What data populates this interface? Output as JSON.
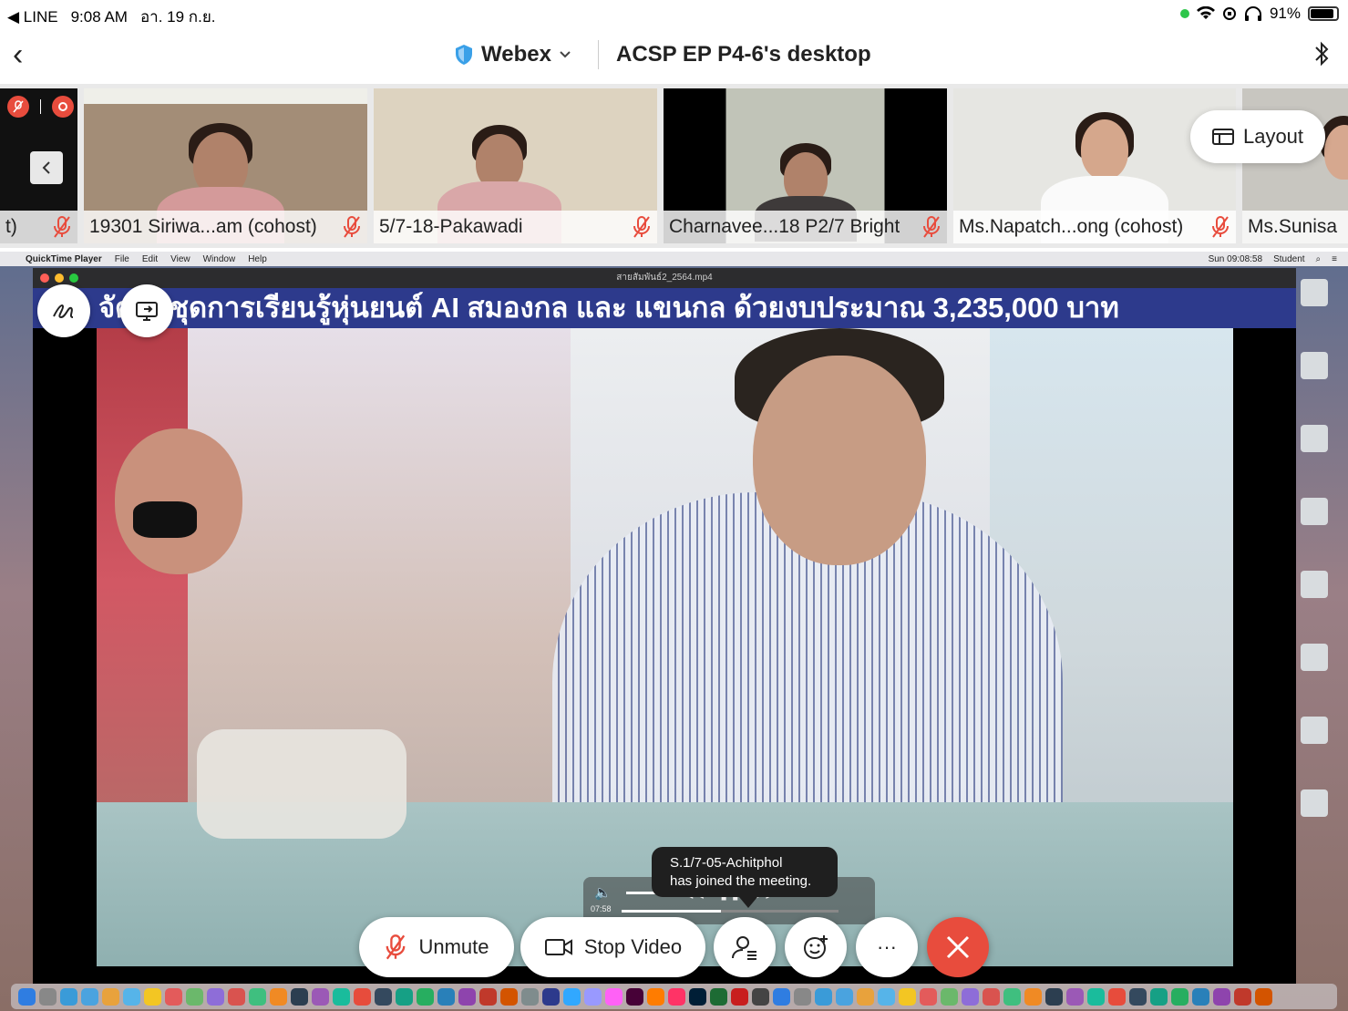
{
  "status_bar": {
    "back_app": "◀ LINE",
    "time": "9:08 AM",
    "date": "อา. 19 ก.ย.",
    "battery": "91%",
    "battery_level": 0.91
  },
  "nav": {
    "app_name": "Webex",
    "title": "ACSP EP P4-6's desktop"
  },
  "participants": [
    {
      "name": "t)"
    },
    {
      "name": "19301 Siriwa...am (cohost)"
    },
    {
      "name": "5/7-18-Pakawadi"
    },
    {
      "name": "Charnavee...18 P2/7 Bright"
    },
    {
      "name": "Ms.Napatch...ong (cohost)"
    },
    {
      "name": "Ms.Sunisa C"
    }
  ],
  "layout_button": "Layout",
  "shared_screen": {
    "menubar": {
      "app": "QuickTime Player",
      "items": [
        "File",
        "Edit",
        "View",
        "Window",
        "Help"
      ],
      "clock": "Sun 09:08:58",
      "user": "Student"
    },
    "window_title": "สายสัมพันธ์2_2564.mp4",
    "banner": "จัดซื้อชุดการเรียนรู้หุ่นยนต์ AI สมองกล และ แขนกล ด้วยงบประมาณ 3,235,000  บาท",
    "player": {
      "time": "07:58",
      "progress": 0.46
    }
  },
  "toast": {
    "line1": "S.1/7-05-Achitphol",
    "line2": "has joined the meeting."
  },
  "controls": {
    "unmute": "Unmute",
    "stop_video": "Stop Video",
    "more": "···"
  },
  "icons": {
    "shield": "shield-icon",
    "accent": "#e84c3d",
    "banner_bg": "#2d3a8c"
  }
}
